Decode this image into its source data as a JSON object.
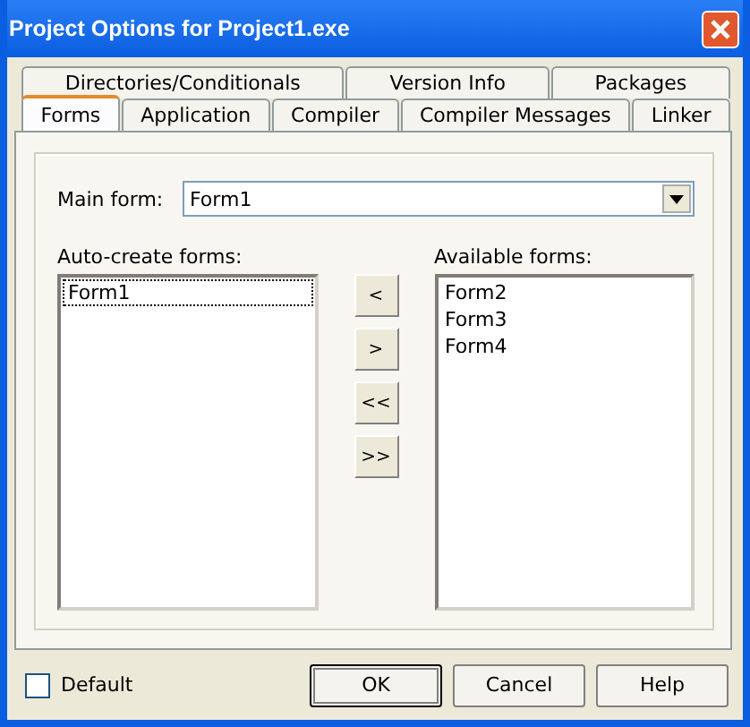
{
  "window": {
    "title": "Project Options for Project1.exe"
  },
  "tab_rows": [
    [
      {
        "label": "Directories/Conditionals",
        "selected": false
      },
      {
        "label": "Version Info",
        "selected": false
      },
      {
        "label": "Packages",
        "selected": false
      }
    ],
    [
      {
        "label": "Forms",
        "selected": true
      },
      {
        "label": "Application",
        "selected": false
      },
      {
        "label": "Compiler",
        "selected": false
      },
      {
        "label": "Compiler Messages",
        "selected": false
      },
      {
        "label": "Linker",
        "selected": false
      }
    ]
  ],
  "main_form": {
    "label": "Main form:",
    "value": "Form1"
  },
  "auto_create_forms": {
    "label": "Auto-create forms:",
    "items": [
      {
        "label": "Form1",
        "selected": true
      }
    ]
  },
  "move_buttons": [
    "<",
    ">",
    "<<",
    ">>"
  ],
  "available_forms": {
    "label": "Available forms:",
    "items": [
      {
        "label": "Form2",
        "selected": false
      },
      {
        "label": "Form3",
        "selected": false
      },
      {
        "label": "Form4",
        "selected": false
      }
    ]
  },
  "default_checkbox": {
    "label": "Default",
    "checked": false
  },
  "buttons": [
    {
      "label": "OK",
      "selected": true
    },
    {
      "label": "Cancel",
      "selected": false
    },
    {
      "label": "Help",
      "selected": false
    }
  ]
}
